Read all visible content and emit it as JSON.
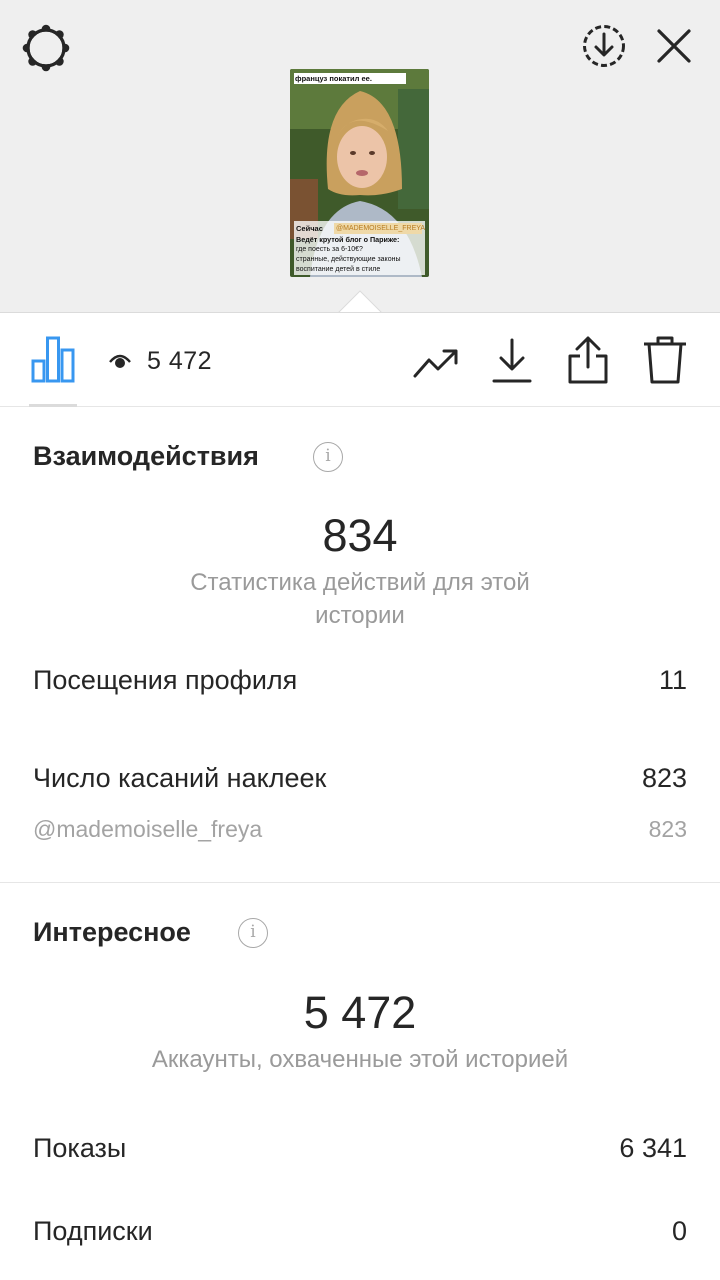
{
  "colors": {
    "accent": "#3897f0",
    "text": "#262626",
    "muted": "#9a9a9a",
    "header_bg": "#efefef"
  },
  "header": {
    "icons": [
      "settings-gear-icon",
      "download-circle-icon",
      "close-icon"
    ],
    "thumbnail": {
      "top_caption": "француз покатил ее.",
      "label": "Сейчас",
      "mention": "@MADEMOISELLE_FREYA",
      "text": "Ведёт крутой блог о Париже:",
      "lines": [
        "где поесть за 6-10€?",
        "странные, действующие законы",
        "воспитание детей в стиле"
      ]
    }
  },
  "toolbar": {
    "views_count": "5 472",
    "icons": [
      "insights-bar-chart-icon",
      "eye-icon",
      "promote-trend-icon",
      "save-download-icon",
      "share-icon",
      "delete-trash-icon"
    ]
  },
  "interactions": {
    "title": "Взаимодействия",
    "total": "834",
    "subtitle": "Статистика действий для этой истории",
    "rows": [
      {
        "label": "Посещения профиля",
        "value": "11"
      },
      {
        "label": "Число касаний наклеек",
        "value": "823"
      }
    ],
    "sub_row": {
      "label": "@mademoiselle_freya",
      "value": "823"
    }
  },
  "discovery": {
    "title": "Интересное",
    "total": "5 472",
    "subtitle": "Аккаунты, охваченные этой историей",
    "rows": [
      {
        "label": "Показы",
        "value": "6 341"
      },
      {
        "label": "Подписки",
        "value": "0"
      }
    ]
  }
}
